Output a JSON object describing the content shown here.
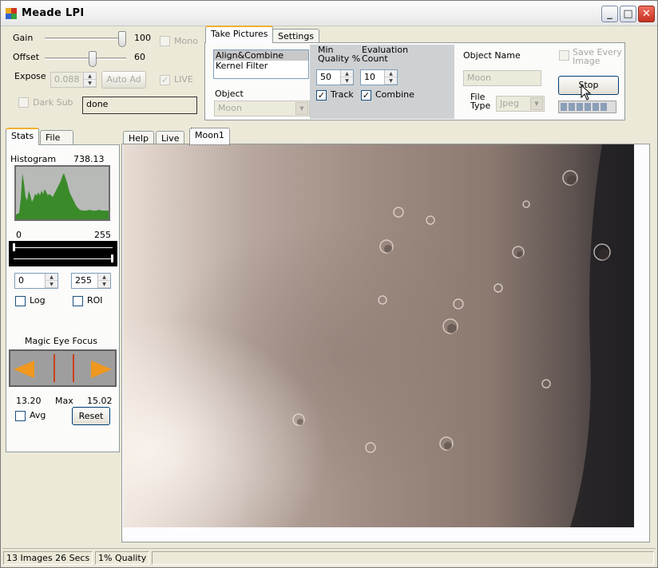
{
  "window": {
    "title": "Meade LPI"
  },
  "controls": {
    "gain": {
      "label": "Gain",
      "value": "100",
      "fraction": 1.0
    },
    "offset": {
      "label": "Offset",
      "value": "60",
      "fraction": 0.6
    },
    "mono_label": "Mono",
    "expose": {
      "label": "Expose",
      "value": "0.088"
    },
    "auto_adj_label": "Auto Ad",
    "live_label": "LIVE",
    "dark_sub_label": "Dark Sub",
    "status_text": "done"
  },
  "take_pictures": {
    "tabs": [
      "Take Pictures",
      "Settings"
    ],
    "mode_list": [
      "Align&Combine",
      "Kernel Filter"
    ],
    "selected_mode": "Align&Combine",
    "object_label": "Object",
    "object_value": "Moon",
    "min_quality_label_1": "Min",
    "min_quality_label_2": "Quality %",
    "min_quality_value": "50",
    "eval_count_label_1": "Evaluation",
    "eval_count_label_2": "Count",
    "eval_count_value": "10",
    "track_label": "Track",
    "combine_label": "Combine",
    "object_name_label": "Object Name",
    "object_name_value": "Moon",
    "file_type_label_1": "File",
    "file_type_label_2": "Type",
    "file_type_value": "Jpeg",
    "save_every_label_1": "Save Every",
    "save_every_label_2": "Image",
    "stop_label": "Stop"
  },
  "left_tabs": [
    "Stats",
    "File"
  ],
  "stats": {
    "histogram_label": "Histogram",
    "histogram_value": "738.13",
    "range_min_label": "0",
    "range_max_label": "255",
    "min_value": "0",
    "max_value": "255",
    "log_label": "Log",
    "roi_label": "ROI",
    "magic_eye_label": "Magic Eye Focus",
    "focus_value": "13.20",
    "max_label": "Max",
    "max_focus_value": "15.02",
    "avg_label": "Avg",
    "reset_label": "Reset"
  },
  "image_tabs": [
    "Help",
    "Live",
    "Moon1"
  ],
  "statusbar": {
    "images_text": "13 Images 26 Secs",
    "quality_text": "1% Quality"
  },
  "colors": {
    "histogram_fill": "#3a8a2a",
    "magic_eye_arrow": "#f09820",
    "close_button": "#d04030"
  }
}
